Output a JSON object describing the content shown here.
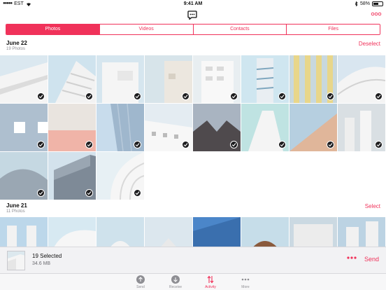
{
  "status_bar": {
    "carrier": "EST",
    "time": "9:41 AM",
    "battery": "58%",
    "battery_level": 0.58
  },
  "top_nav": {
    "chat_icon": "chat-bubble-icon",
    "more_icon": "more-options-icon"
  },
  "segments": [
    {
      "label": "Photos",
      "active": true
    },
    {
      "label": "Videos",
      "active": false
    },
    {
      "label": "Contacts",
      "active": false
    },
    {
      "label": "Files",
      "active": false
    }
  ],
  "sections": [
    {
      "title": "June 22",
      "subtitle": "19 Photos",
      "action": "Deselect"
    },
    {
      "title": "June 21",
      "subtitle": "11 Photos",
      "action": "Select"
    }
  ],
  "selection_bar": {
    "count_label": "19 Selected",
    "size_label": "34.6 MB",
    "send_label": "Send",
    "more_icon": "more-dots-icon"
  },
  "tab_bar": [
    {
      "label": "Send",
      "icon": "arrow-up-circle-icon",
      "active": false
    },
    {
      "label": "Receive",
      "icon": "arrow-down-circle-icon",
      "active": false
    },
    {
      "label": "Activity",
      "icon": "transfer-arrows-icon",
      "active": true
    },
    {
      "label": "More",
      "icon": "more-dots-icon",
      "active": false
    }
  ],
  "colors": {
    "accent": "#f0325a",
    "check": "#1c1c1e"
  }
}
